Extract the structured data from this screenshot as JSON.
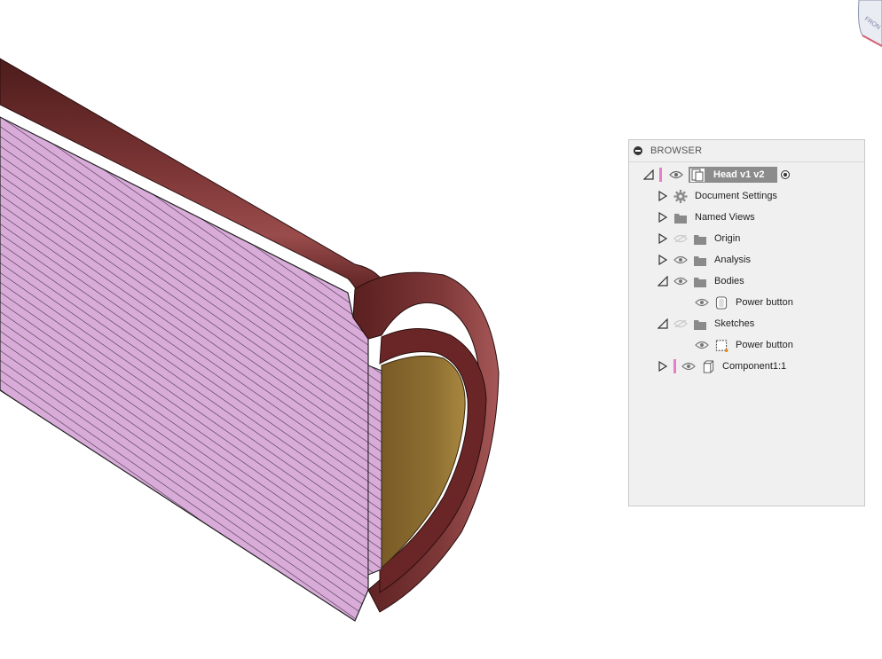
{
  "browser": {
    "title": "BROWSER",
    "root": {
      "label": "Head v1 v2",
      "accent_color": "#e67fc9"
    },
    "items": [
      {
        "label": "Document Settings",
        "expander": "collapsed",
        "icon": "gear-icon"
      },
      {
        "label": "Named Views",
        "expander": "collapsed",
        "icon": "folder-icon"
      },
      {
        "label": "Origin",
        "expander": "collapsed",
        "icon": "folder-icon",
        "visibility": "hidden"
      },
      {
        "label": "Analysis",
        "expander": "collapsed",
        "icon": "folder-icon",
        "visibility": "visible"
      },
      {
        "label": "Bodies",
        "expander": "expanded",
        "icon": "folder-icon",
        "visibility": "visible"
      },
      {
        "label": "Power button",
        "icon": "body-icon",
        "visibility": "visible"
      },
      {
        "label": "Sketches",
        "expander": "expanded",
        "icon": "folder-icon",
        "visibility": "hidden"
      },
      {
        "label": "Power button",
        "icon": "sketch-icon",
        "visibility": "visible"
      },
      {
        "label": "Component1:1",
        "expander": "collapsed",
        "icon": "component-icon",
        "visibility": "visible",
        "accent_color": "#e67fc9"
      }
    ]
  },
  "viewcube": {
    "face_label": "FRON"
  },
  "colors": {
    "section_fill": "#d7a8d9",
    "body_maroon": "#6f2a2a",
    "button_gold": "#8a6b2e"
  }
}
